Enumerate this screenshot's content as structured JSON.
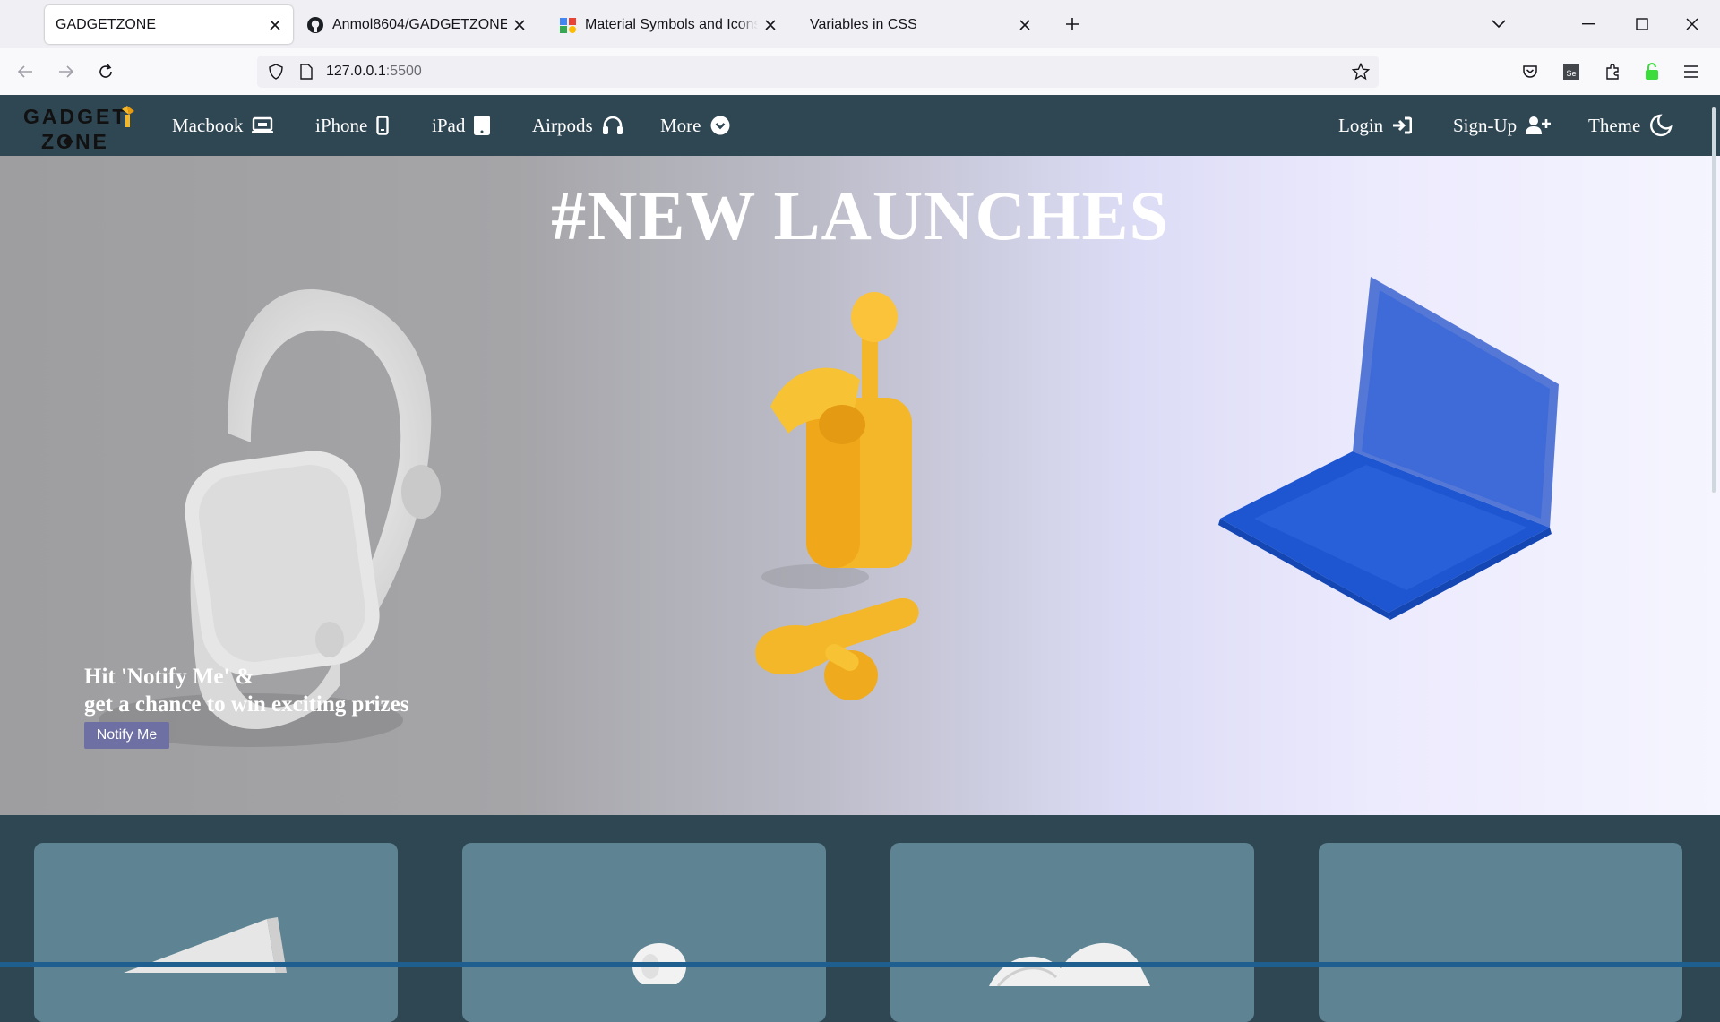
{
  "browser": {
    "tabs": [
      {
        "title": "GADGETZONE",
        "active": true,
        "favicon": "none"
      },
      {
        "title": "Anmol8604/GADGETZONE",
        "active": false,
        "favicon": "github-icon"
      },
      {
        "title": "Material Symbols and Icons - Goo",
        "active": false,
        "favicon": "material-icon"
      },
      {
        "title": "Variables in CSS",
        "active": false,
        "favicon": "none"
      }
    ],
    "url": {
      "host": "127.0.0.1",
      "port": ":5500"
    }
  },
  "site": {
    "logo_text": {
      "line1": "GADGET",
      "line2": "ZONE"
    },
    "nav": [
      {
        "label": "Macbook",
        "icon": "laptop-icon"
      },
      {
        "label": "iPhone",
        "icon": "phone-icon"
      },
      {
        "label": "iPad",
        "icon": "tablet-icon"
      },
      {
        "label": "Airpods",
        "icon": "headphones-icon"
      },
      {
        "label": "More",
        "icon": "chevron-circle-icon"
      }
    ],
    "nav_right": [
      {
        "label": "Login",
        "icon": "login-icon"
      },
      {
        "label": "Sign-Up",
        "icon": "user-plus-icon"
      },
      {
        "label": "Theme",
        "icon": "moon-icon"
      }
    ]
  },
  "hero": {
    "title": "#NEW LAUNCHES",
    "promo_line1": "Hit 'Notify Me' &",
    "promo_line2": "get a chance to win exciting prizes",
    "button_label": "Notify Me"
  },
  "colors": {
    "nav_bg": "#2f4653",
    "card_bg": "#5e8494",
    "button_bg": "#6e6fa3",
    "airpods": "#f5b72a",
    "laptop": "#1d56d0"
  }
}
